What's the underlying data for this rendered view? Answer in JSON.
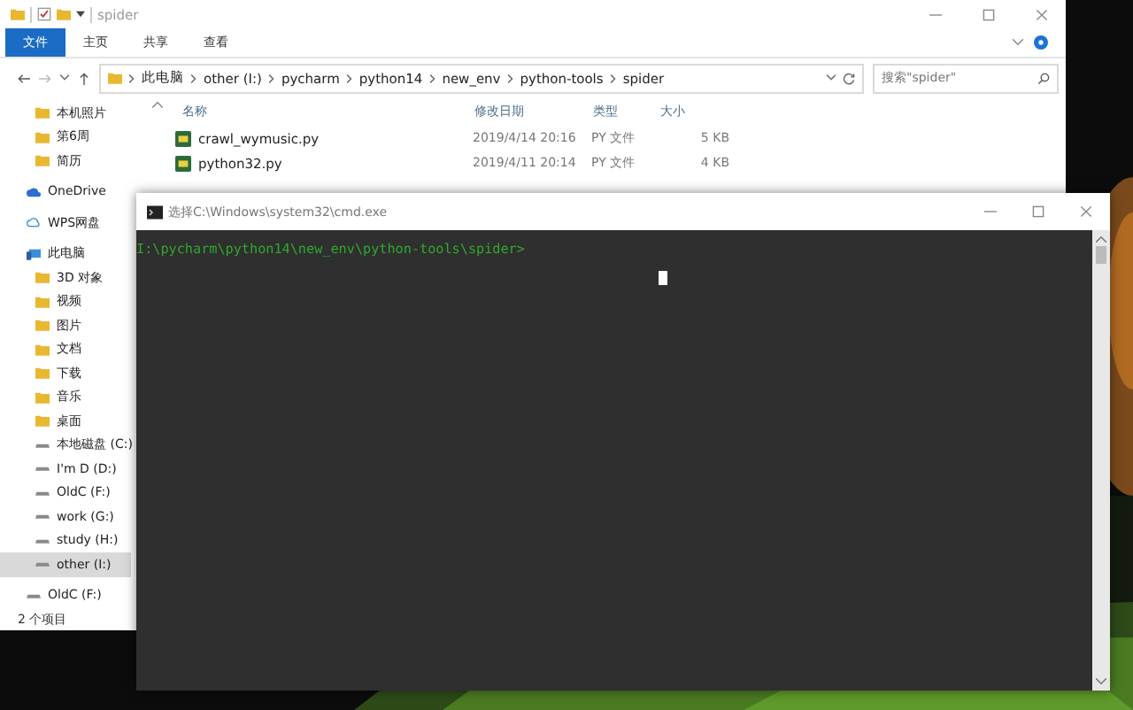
{
  "explorer": {
    "title": "spider",
    "ribbon_tabs": [
      {
        "label": "文件",
        "kind": "file"
      },
      {
        "label": "主页",
        "kind": "tab"
      },
      {
        "label": "共享",
        "kind": "tab"
      },
      {
        "label": "查看",
        "kind": "tab"
      }
    ],
    "breadcrumb": [
      "此电脑",
      "other (I:)",
      "pycharm",
      "python14",
      "new_env",
      "python-tools",
      "spider"
    ],
    "search": {
      "placeholder": "搜索\"spider\""
    },
    "sidebar": [
      {
        "label": "本机照片",
        "kind": "folder",
        "selected": false
      },
      {
        "label": "第6周",
        "kind": "folder",
        "selected": false
      },
      {
        "label": "简历",
        "kind": "folder",
        "selected": false
      },
      {
        "label": "OneDrive",
        "kind": "cloud",
        "selected": false
      },
      {
        "label": "WPS网盘",
        "kind": "netdisk",
        "selected": false
      },
      {
        "label": "此电脑",
        "kind": "computer",
        "selected": false,
        "children": [
          {
            "label": "3D 对象",
            "kind": "folder",
            "selected": false
          },
          {
            "label": "视频",
            "kind": "folder",
            "selected": false
          },
          {
            "label": "图片",
            "kind": "folder",
            "selected": false
          },
          {
            "label": "文档",
            "kind": "folder",
            "selected": false
          },
          {
            "label": "下载",
            "kind": "folder",
            "selected": false
          },
          {
            "label": "音乐",
            "kind": "folder",
            "selected": false
          },
          {
            "label": "桌面",
            "kind": "folder",
            "selected": false
          },
          {
            "label": "本地磁盘 (C:)",
            "kind": "drive",
            "selected": false
          },
          {
            "label": "I'm D (D:)",
            "kind": "drive",
            "selected": false
          },
          {
            "label": "OldC (F:)",
            "kind": "drive",
            "selected": false
          },
          {
            "label": "work (G:)",
            "kind": "drive",
            "selected": false
          },
          {
            "label": "study (H:)",
            "kind": "drive",
            "selected": false
          },
          {
            "label": "other (I:)",
            "kind": "drive",
            "selected": true
          }
        ]
      },
      {
        "label": "OldC (F:)",
        "kind": "drive",
        "selected": false
      }
    ],
    "table": {
      "columns": [
        "名称",
        "修改日期",
        "类型",
        "大小"
      ],
      "rows": [
        [
          "crawl_wymusic.py",
          "2019/4/14 20:16",
          "PY 文件",
          "5 KB"
        ],
        [
          "python32.py",
          "2019/4/11 20:14",
          "PY 文件",
          "4 KB"
        ]
      ]
    },
    "status_bar": "2 个项目"
  },
  "cmd": {
    "title": "选择C:\\Windows\\system32\\cmd.exe",
    "lines": [
      "I:\\pycharm\\python14\\new_env\\python-tools\\spider>"
    ]
  }
}
